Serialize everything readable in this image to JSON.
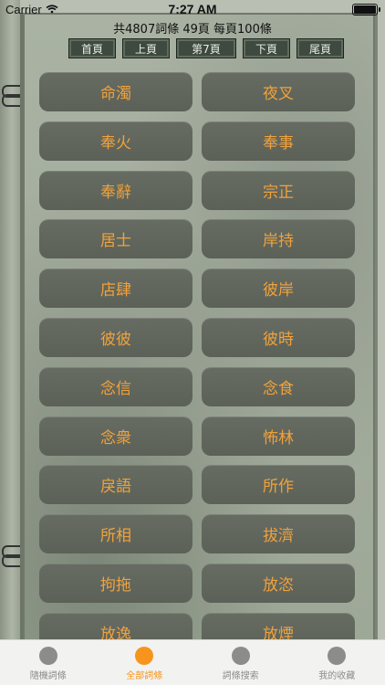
{
  "status": {
    "carrier": "Carrier",
    "time": "7:27 AM"
  },
  "summary": "共4807詞條 49頁 每頁100條",
  "pager": [
    "首頁",
    "上頁",
    "第7頁",
    "下頁",
    "尾頁"
  ],
  "words": [
    "命濁",
    "夜叉",
    "奉火",
    "奉事",
    "奉辭",
    "宗正",
    "居士",
    "岸持",
    "店肆",
    "彼岸",
    "彼彼",
    "彼時",
    "念信",
    "念食",
    "念衆",
    "怖林",
    "戾語",
    "所作",
    "所相",
    "拔濟",
    "拘拖",
    "放恣",
    "放逸",
    "放煙"
  ],
  "tabs": [
    {
      "label": "隨機詞條",
      "icon": "circle-icon",
      "active": false
    },
    {
      "label": "全部詞條",
      "icon": "circle-icon",
      "active": true
    },
    {
      "label": "詞條搜索",
      "icon": "circle-icon",
      "active": false
    },
    {
      "label": "我的收藏",
      "icon": "circle-icon",
      "active": false
    }
  ],
  "colors": {
    "accent": "#f7941d",
    "word_text": "#f0a23c",
    "button_bg": "#5f645b"
  },
  "battery_level": 1.0
}
